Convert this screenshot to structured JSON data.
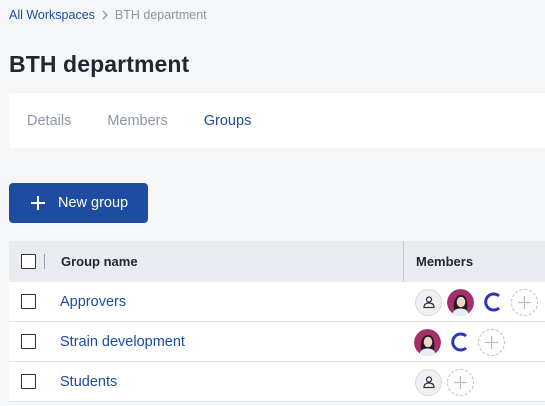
{
  "breadcrumb": {
    "root": "All Workspaces",
    "current": "BTH department"
  },
  "page": {
    "title": "BTH department"
  },
  "tabs": [
    {
      "label": "Details",
      "active": false
    },
    {
      "label": "Members",
      "active": false
    },
    {
      "label": "Groups",
      "active": true
    }
  ],
  "actions": {
    "new_group": "New group"
  },
  "table": {
    "headers": {
      "name": "Group name",
      "members": "Members"
    },
    "rows": [
      {
        "name": "Approvers",
        "members": [
          "user-icon",
          "avatar-woman",
          "letter-c-icon",
          "add-member-icon"
        ]
      },
      {
        "name": "Strain development",
        "members": [
          "avatar-woman",
          "letter-c-icon",
          "add-member-icon"
        ]
      },
      {
        "name": "Students",
        "members": [
          "user-icon",
          "add-member-icon"
        ]
      }
    ]
  },
  "colors": {
    "accent": "#1d4ca1",
    "avatar_bg": "#a3306b"
  }
}
